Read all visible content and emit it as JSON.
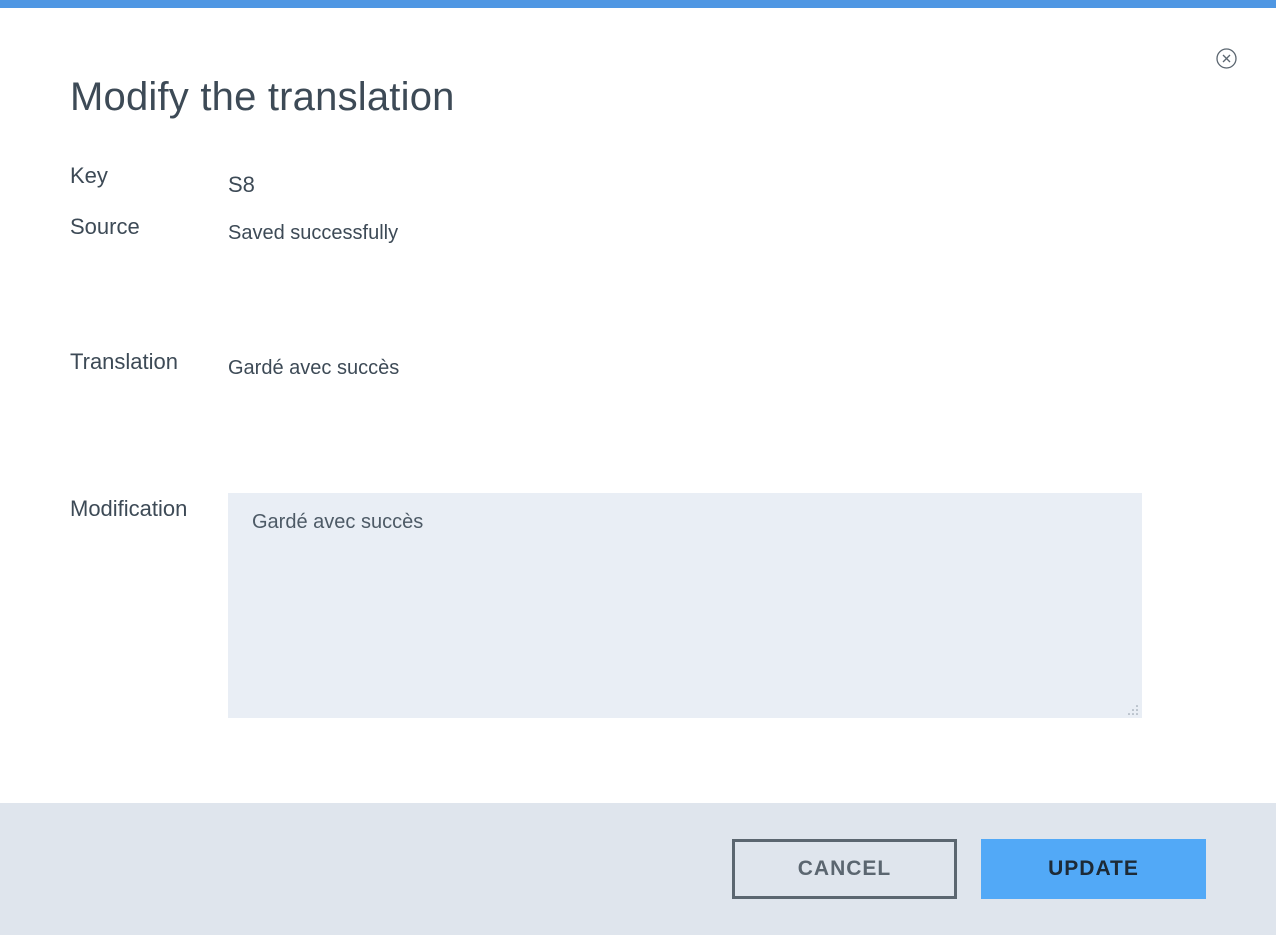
{
  "dialog": {
    "title": "Modify the translation",
    "close_icon": "close-circle-icon"
  },
  "fields": {
    "key_label": "Key",
    "key_value": "S8",
    "source_label": "Source",
    "source_value": "Saved successfully",
    "translation_label": "Translation",
    "translation_value": "Gardé avec succès",
    "modification_label": "Modification",
    "modification_value": "Gardé avec succès"
  },
  "footer": {
    "cancel_label": "CANCEL",
    "update_label": "UPDATE"
  },
  "colors": {
    "accent_bar": "#4f97e3",
    "primary_button": "#52a9f7",
    "footer_bg": "#dfe5ed",
    "textarea_bg": "#e9eef5"
  }
}
